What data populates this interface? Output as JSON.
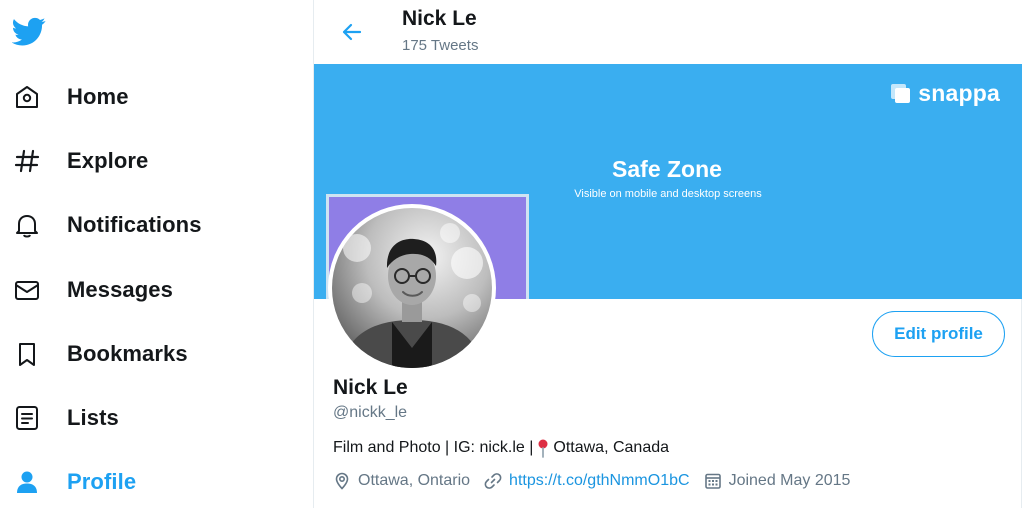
{
  "sidebar": {
    "logo": "twitter-bird-icon",
    "items": [
      {
        "label": "Home",
        "icon": "home-icon"
      },
      {
        "label": "Explore",
        "icon": "hashtag-icon"
      },
      {
        "label": "Notifications",
        "icon": "bell-icon"
      },
      {
        "label": "Messages",
        "icon": "envelope-icon"
      },
      {
        "label": "Bookmarks",
        "icon": "bookmark-icon"
      },
      {
        "label": "Lists",
        "icon": "list-icon"
      },
      {
        "label": "Profile",
        "icon": "person-icon",
        "active": true
      }
    ]
  },
  "header": {
    "name": "Nick Le",
    "tweet_count": "175 Tweets"
  },
  "banner": {
    "brand": "snappa",
    "safe_zone_title": "Safe Zone",
    "safe_zone_subtitle": "Visible on mobile and desktop screens",
    "color": "#3aaef0"
  },
  "profile": {
    "name": "Nick Le",
    "handle": "@nickk_le",
    "bio_text": "Film and Photo | IG: nick.le |",
    "bio_location": "Ottawa, Canada",
    "location": "Ottawa, Ontario",
    "url": "https://t.co/gthNmmO1bC",
    "joined": "Joined May 2015",
    "edit_button": "Edit profile"
  },
  "colors": {
    "accent": "#1da1f2",
    "secondary_text": "#657786"
  }
}
